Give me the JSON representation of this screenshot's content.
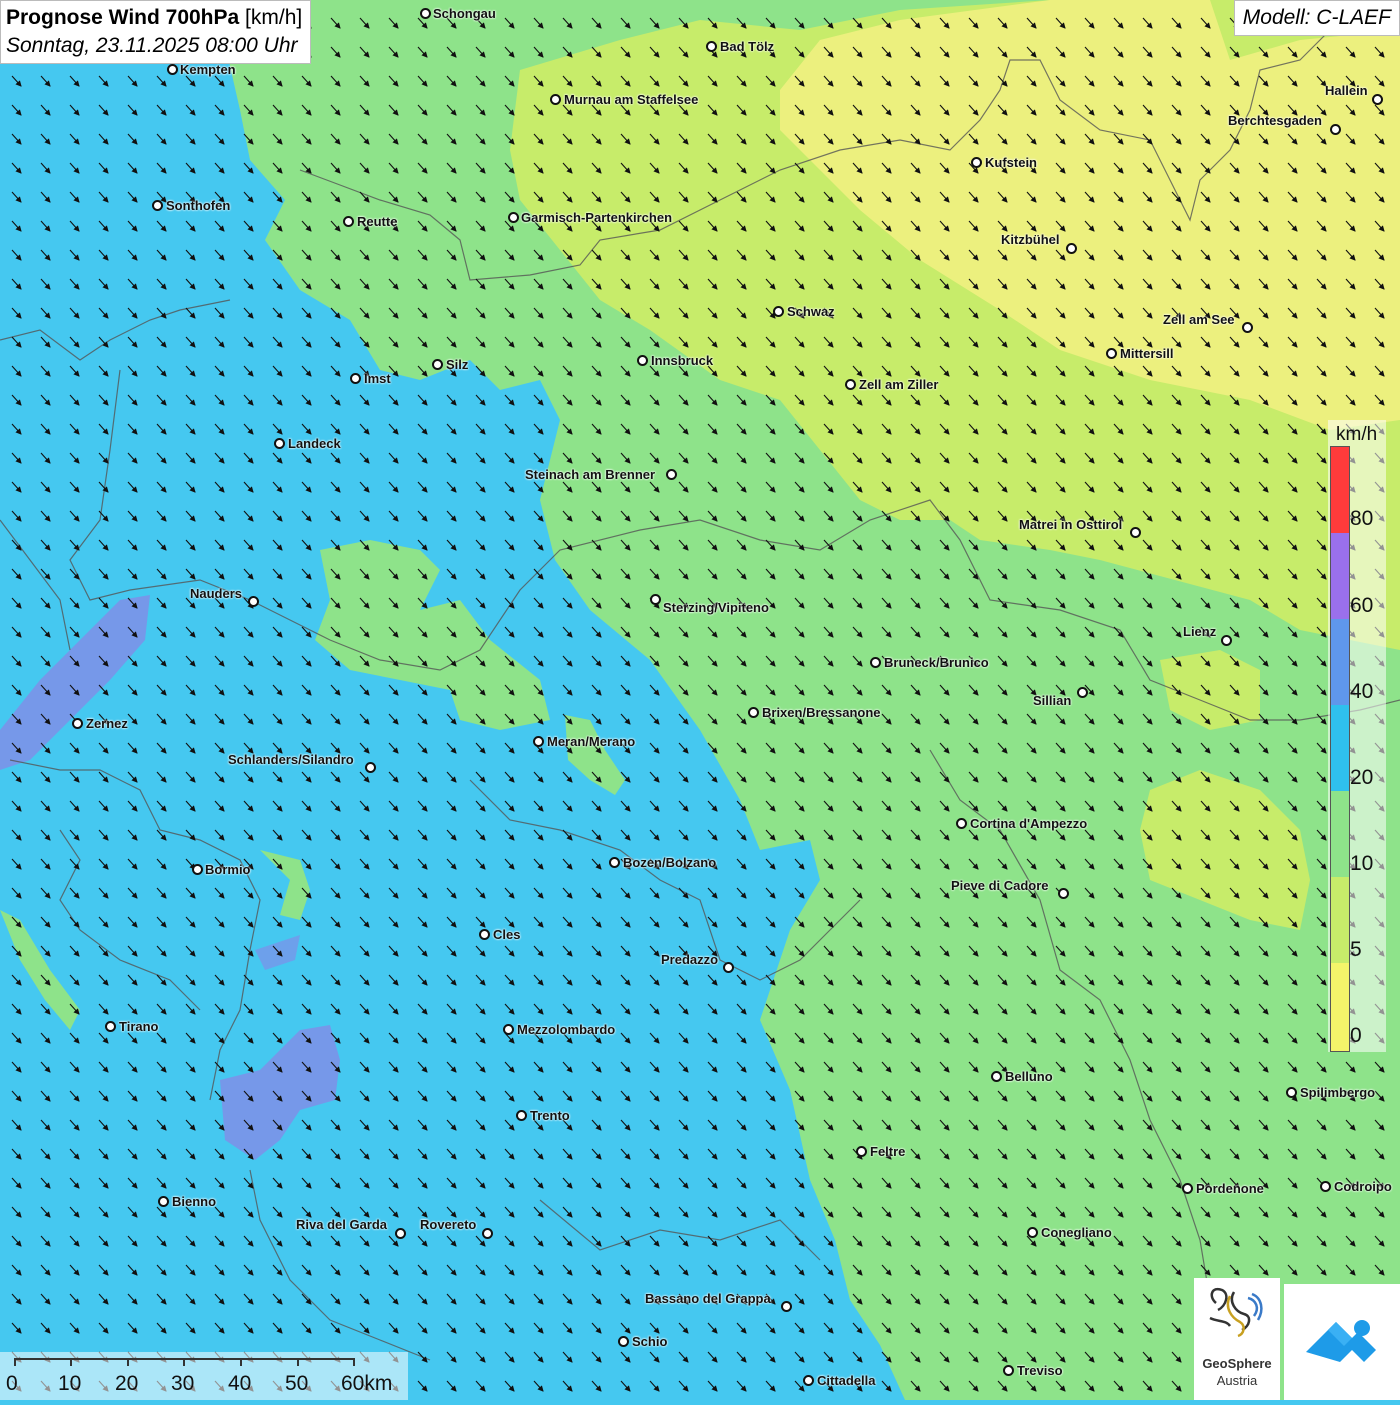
{
  "header": {
    "title_main": "Prognose Wind 700hPa",
    "title_unit": "[km/h]",
    "subtitle": "Sonntag, 23.11.2025 08:00 Uhr",
    "model": "Modell: C-LAEF"
  },
  "colors": {
    "zone_blue": "#45c8f0",
    "zone_green": "#8ee38a",
    "zone_light_green": "#c7ec6a",
    "zone_yellow": "#ecf07e",
    "zone_purple": "#7f8fe8",
    "arrow": "#111111",
    "border": "#555555"
  },
  "cities": [
    {
      "name": "Schongau"
    },
    {
      "name": "Bad Tölz"
    },
    {
      "name": "Kempten"
    },
    {
      "name": "Murnau am Staffelsee"
    },
    {
      "name": "Hallein"
    },
    {
      "name": "Berchtesgaden"
    },
    {
      "name": "Kufstein"
    },
    {
      "name": "Sonthofen"
    },
    {
      "name": "Reutte"
    },
    {
      "name": "Garmisch-Partenkirchen"
    },
    {
      "name": "Kitzbühel"
    },
    {
      "name": "Schwaz"
    },
    {
      "name": "Zell am See"
    },
    {
      "name": "Mittersill"
    },
    {
      "name": "Silz"
    },
    {
      "name": "Innsbruck"
    },
    {
      "name": "Imst"
    },
    {
      "name": "Zell am Ziller"
    },
    {
      "name": "Landeck"
    },
    {
      "name": "Steinach am Brenner"
    },
    {
      "name": "Matrei in Osttirol"
    },
    {
      "name": "Nauders"
    },
    {
      "name": "Sterzing/Vipiteno"
    },
    {
      "name": "Lienz"
    },
    {
      "name": "Bruneck/Brunico"
    },
    {
      "name": "Sillian"
    },
    {
      "name": "Zernez"
    },
    {
      "name": "Brixen/Bressanone"
    },
    {
      "name": "Meran/Merano"
    },
    {
      "name": "Schlanders/Silandro"
    },
    {
      "name": "Cortina d'Ampezzo"
    },
    {
      "name": "Bormio"
    },
    {
      "name": "Bozen/Bolzano"
    },
    {
      "name": "Pieve di Cadore"
    },
    {
      "name": "Cles"
    },
    {
      "name": "Predazzo"
    },
    {
      "name": "Tirano"
    },
    {
      "name": "Mezzolombardo"
    },
    {
      "name": "Belluno"
    },
    {
      "name": "Spilimbergo"
    },
    {
      "name": "Trento"
    },
    {
      "name": "Feltre"
    },
    {
      "name": "Bienno"
    },
    {
      "name": "Pordenone"
    },
    {
      "name": "Codroipo"
    },
    {
      "name": "Riva del Garda"
    },
    {
      "name": "Rovereto"
    },
    {
      "name": "Conegliano"
    },
    {
      "name": "Bassano del Grappa"
    },
    {
      "name": "Schio"
    },
    {
      "name": "Treviso"
    },
    {
      "name": "Cittadella"
    }
  ],
  "legend": {
    "unit": "km/h",
    "labels": [
      "80",
      "60",
      "40",
      "20",
      "10",
      "5",
      "0"
    ],
    "colors": [
      "#ff3b3b",
      "#9a70ec",
      "#5f97ec",
      "#2fc0ee",
      "#8ee38a",
      "#c7ec6a",
      "#f4f46a"
    ]
  },
  "scale": {
    "labels": [
      "0",
      "10",
      "20",
      "30",
      "40",
      "50",
      "60km"
    ]
  },
  "logos": {
    "geosphere_line1": "GeoSphere",
    "geosphere_line2": "Austria",
    "geosphere_icon": "geosphere-wave-icon",
    "app_icon": "weather-app-icon"
  }
}
